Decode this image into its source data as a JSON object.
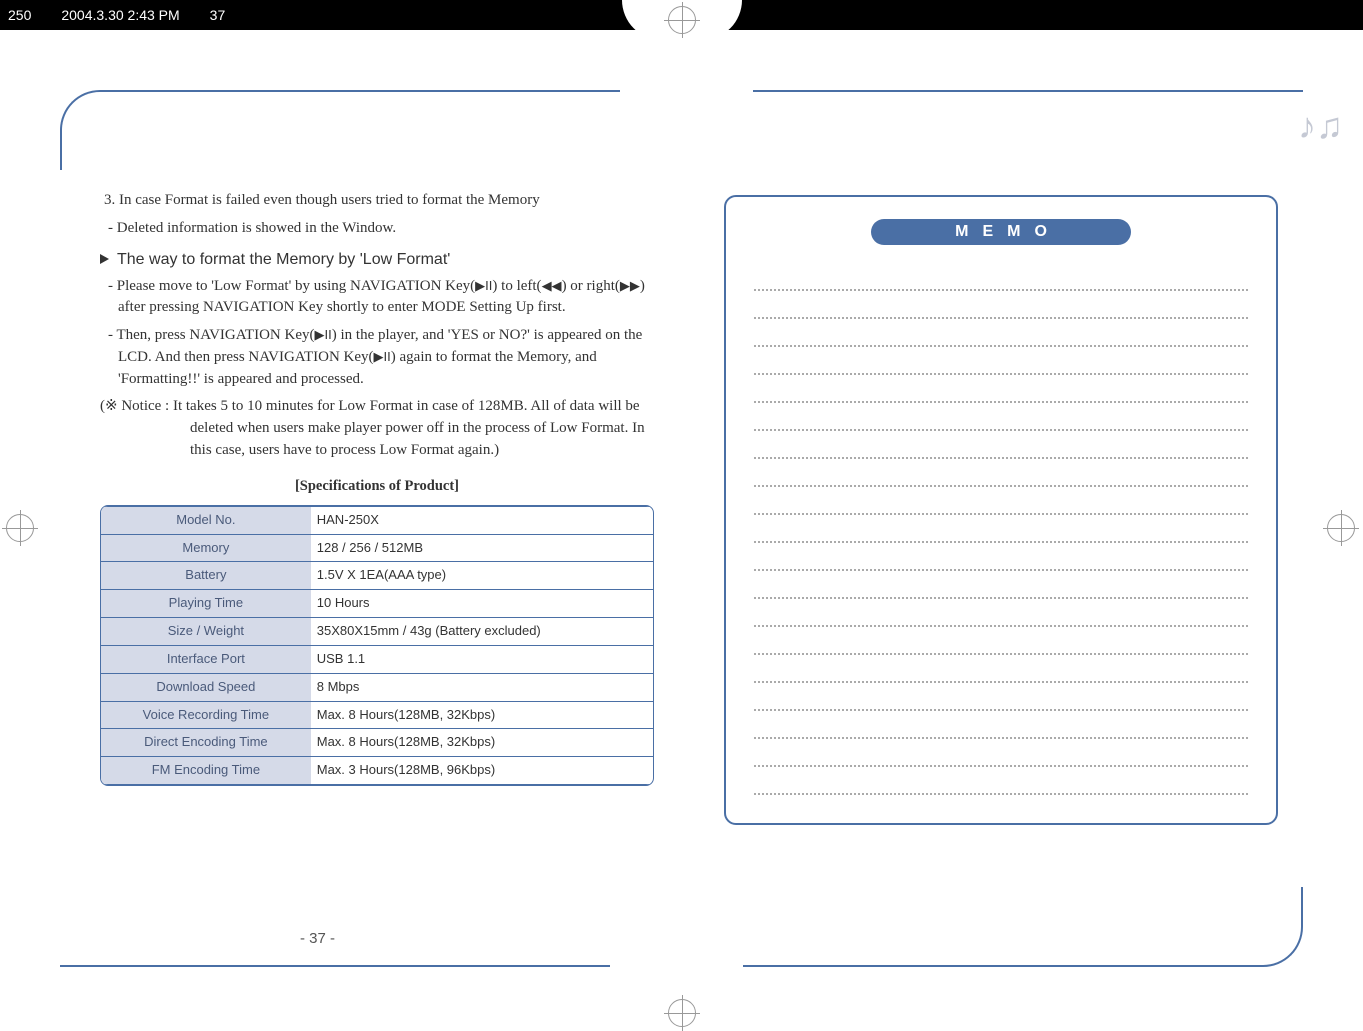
{
  "header": {
    "file_label": "250",
    "timestamp": "2004.3.30 2:43 PM",
    "page_marker": "37"
  },
  "left": {
    "item3": "3. In case Format is failed even though users tried to format the Memory",
    "item3_sub": "- Deleted information is showed in the Window.",
    "section_title": "The way to format the Memory by 'Low Format'",
    "p1a": "- Please move to 'Low Format' by using NAVIGATION Key(",
    "p1b": ") to left(",
    "p1c": ") or right(",
    "p1d": ") after pressing NAVIGATION Key shortly to enter MODE Setting Up first.",
    "p2a": "- Then, press NAVIGATION Key(",
    "p2b": ") in the player, and 'YES or NO?' is appeared on the LCD. And then press NAVIGATION Key(",
    "p2c": ") again to format the Memory, and 'Formatting!!' is appeared and processed.",
    "notice_lead": "(※ Notice : ",
    "notice_body": "It takes 5 to 10 minutes for Low Format in case of 128MB. All of data will be deleted when users make player power off in the process of Low Format. In this case, users have to process Low Format again.)",
    "spec_title": "[Specifications of Product]",
    "specs": [
      {
        "label": "Model No.",
        "value": "HAN-250X"
      },
      {
        "label": "Memory",
        "value": "128 / 256 / 512MB"
      },
      {
        "label": "Battery",
        "value": "1.5V X 1EA(AAA type)"
      },
      {
        "label": "Playing Time",
        "value": "10 Hours"
      },
      {
        "label": "Size / Weight",
        "value": "35X80X15mm / 43g (Battery excluded)"
      },
      {
        "label": "Interface Port",
        "value": "USB 1.1"
      },
      {
        "label": "Download Speed",
        "value": "8 Mbps"
      },
      {
        "label": "Voice Recording Time",
        "value": "Max. 8 Hours(128MB, 32Kbps)"
      },
      {
        "label": "Direct Encoding Time",
        "value": "Max. 8 Hours(128MB, 32Kbps)"
      },
      {
        "label": "FM Encoding Time",
        "value": "Max. 3 Hours(128MB, 96Kbps)"
      }
    ],
    "page_number": "- 37 -"
  },
  "right": {
    "memo_heading": "MEMO",
    "line_count": 19
  },
  "icons": {
    "play_pause": "▶II",
    "rew": "◀◀",
    "ffw": "▶▶",
    "music": "♪♫"
  }
}
